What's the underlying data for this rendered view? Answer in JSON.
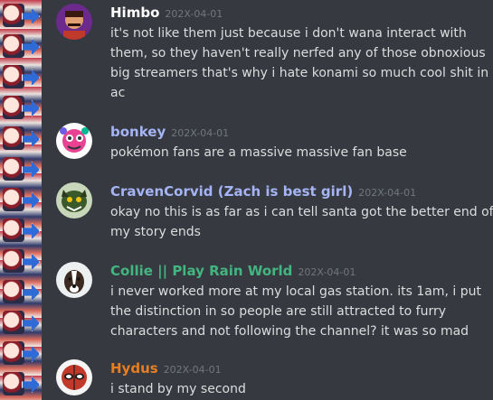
{
  "theme": {
    "background": "#36393f",
    "text": "#dcddde",
    "timestamp": "#72767d"
  },
  "messages": [
    {
      "username": "Himbo",
      "color": "#ffffff",
      "timestamp": "202X-04-01",
      "lines": [
        "it's not like them just because i don't wana interact with",
        "them, so they haven't really nerfed any of those obnoxious",
        "big streamers that's why i hate konami so much cool shit in",
        "ac"
      ]
    },
    {
      "username": "bonkey",
      "color": "#a5b4f5",
      "timestamp": "202X-04-01",
      "lines": [
        "pokémon fans are a massive massive fan base"
      ]
    },
    {
      "username": "CravenCorvid (Zach is best girl)",
      "color": "#a5b4f5",
      "timestamp": "202X-04-01",
      "lines": [
        "okay no this is as far as i can tell santa got the better end of",
        "my story ends"
      ]
    },
    {
      "username": "Collie || Play Rain World",
      "color": "#43b581",
      "timestamp": "202X-04-01",
      "lines": [
        "i never worked more at my local gas station. its 1am, i put",
        "the distinction in so people are still attracted to furry",
        "characters and not following the channel? it was so mad"
      ]
    },
    {
      "username": "Hydus",
      "color": "#e67e22",
      "timestamp": "202X-04-01",
      "lines": [
        "i stand by my second"
      ]
    }
  ]
}
